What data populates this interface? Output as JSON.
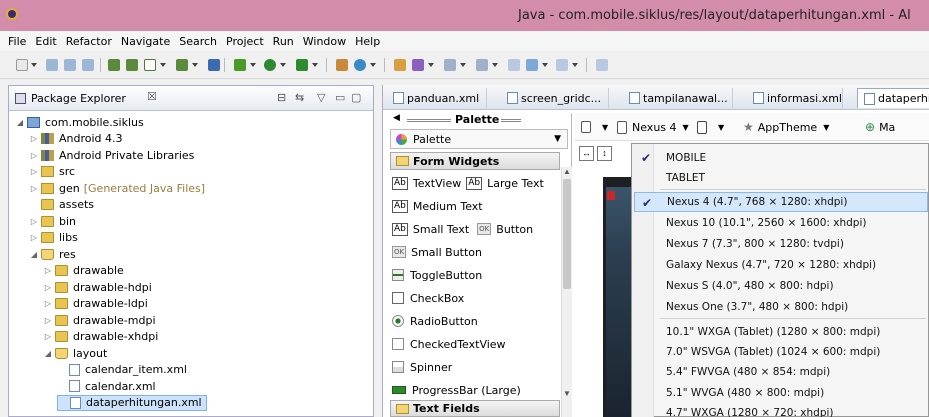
{
  "window": {
    "title": "Java - com.mobile.siklus/res/layout/dataperhitungan.xml - Al"
  },
  "menu": [
    "File",
    "Edit",
    "Refactor",
    "Navigate",
    "Search",
    "Project",
    "Run",
    "Window",
    "Help"
  ],
  "explorer": {
    "title": "Package Explorer",
    "close": "☒",
    "tree": [
      {
        "label": "com.mobile.siklus",
        "icon": "project-icon",
        "level": 0,
        "twisty": "open"
      },
      {
        "label": "Android 4.3",
        "icon": "library-icon",
        "level": 1,
        "twisty": "closed"
      },
      {
        "label": "Android Private Libraries",
        "icon": "library-icon",
        "level": 1,
        "twisty": "closed"
      },
      {
        "label": "src",
        "icon": "source-folder-icon",
        "level": 1,
        "twisty": "closed"
      },
      {
        "label": "gen",
        "note": "[Generated Java Files]",
        "icon": "source-folder-icon",
        "level": 1,
        "twisty": "closed"
      },
      {
        "label": "assets",
        "icon": "folder-icon",
        "level": 1,
        "twisty": ""
      },
      {
        "label": "bin",
        "icon": "folder-icon",
        "level": 1,
        "twisty": "closed"
      },
      {
        "label": "libs",
        "icon": "folder-icon",
        "level": 1,
        "twisty": "closed"
      },
      {
        "label": "res",
        "icon": "folder-open-icon",
        "level": 1,
        "twisty": "open"
      },
      {
        "label": "drawable",
        "icon": "folder-icon",
        "level": 2,
        "twisty": "closed"
      },
      {
        "label": "drawable-hdpi",
        "icon": "folder-icon",
        "level": 2,
        "twisty": "closed"
      },
      {
        "label": "drawable-ldpi",
        "icon": "folder-icon",
        "level": 2,
        "twisty": "closed"
      },
      {
        "label": "drawable-mdpi",
        "icon": "folder-icon",
        "level": 2,
        "twisty": "closed"
      },
      {
        "label": "drawable-xhdpi",
        "icon": "folder-icon",
        "level": 2,
        "twisty": "closed"
      },
      {
        "label": "layout",
        "icon": "folder-open-icon",
        "level": 2,
        "twisty": "open"
      },
      {
        "label": "calendar_item.xml",
        "icon": "xml-file-icon",
        "level": 3,
        "twisty": ""
      },
      {
        "label": "calendar.xml",
        "icon": "xml-file-icon",
        "level": 3,
        "twisty": ""
      },
      {
        "label": "dataperhitungan.xml",
        "icon": "xml-file-icon",
        "level": 3,
        "twisty": "",
        "selected": true
      }
    ]
  },
  "editor": {
    "tabs": [
      {
        "label": "panduan.xml"
      },
      {
        "label": "screen_gridc..."
      },
      {
        "label": "tampilanawal..."
      },
      {
        "label": "informasi.xml"
      },
      {
        "label": "dataperhi",
        "active": true
      }
    ]
  },
  "palette": {
    "header": "Palette",
    "selector": "Palette",
    "category_form": "Form Widgets",
    "category_text": "Text Fields",
    "items": [
      {
        "label": "TextView",
        "label2": "Large Text",
        "icon": "textview-icon"
      },
      {
        "label": "Medium Text",
        "icon": "textview-icon"
      },
      {
        "label": "Small Text",
        "label2": "Button",
        "icon": "textview-icon"
      },
      {
        "label": "Small Button",
        "icon": "button-icon"
      },
      {
        "label": "ToggleButton",
        "icon": "toggle-icon"
      },
      {
        "label": "CheckBox",
        "icon": "checkbox-icon"
      },
      {
        "label": "RadioButton",
        "icon": "radio-icon"
      },
      {
        "label": "CheckedTextView",
        "icon": "checked-textview-icon"
      },
      {
        "label": "Spinner",
        "icon": "spinner-icon"
      },
      {
        "label": "ProgressBar (Large)",
        "icon": "progressbar-icon"
      }
    ],
    "ab_label": "Ab",
    "ok_label": "OK"
  },
  "layout_toolbar": {
    "device": "Nexus 4",
    "theme": "AppTheme",
    "activity": "Ma"
  },
  "device_menu": {
    "items": [
      {
        "label": "MOBILE",
        "checked": true
      },
      {
        "label": "TABLET"
      },
      {
        "label": "Nexus 4 (4.7\", 768 × 1280: xhdpi)",
        "checked": true,
        "hover": true
      },
      {
        "label": "Nexus 10 (10.1\", 2560 × 1600: xhdpi)"
      },
      {
        "label": "Nexus 7 (7.3\", 800 × 1280: tvdpi)"
      },
      {
        "label": "Galaxy Nexus (4.7\", 720 × 1280: xhdpi)"
      },
      {
        "label": "Nexus S (4.0\", 480 × 800: hdpi)"
      },
      {
        "label": "Nexus One (3.7\", 480 × 800: hdpi)"
      },
      {
        "label": "10.1\" WXGA (Tablet) (1280 × 800: mdpi)"
      },
      {
        "label": "7.0\" WSVGA (Tablet) (1024 × 600: mdpi)"
      },
      {
        "label": "5.4\" FWVGA (480 × 854: mdpi)"
      },
      {
        "label": "5.1\" WVGA (480 × 800: mdpi)"
      },
      {
        "label": "4.7\" WXGA (1280 × 720: xhdpi)"
      }
    ],
    "check_glyph": "✔"
  }
}
